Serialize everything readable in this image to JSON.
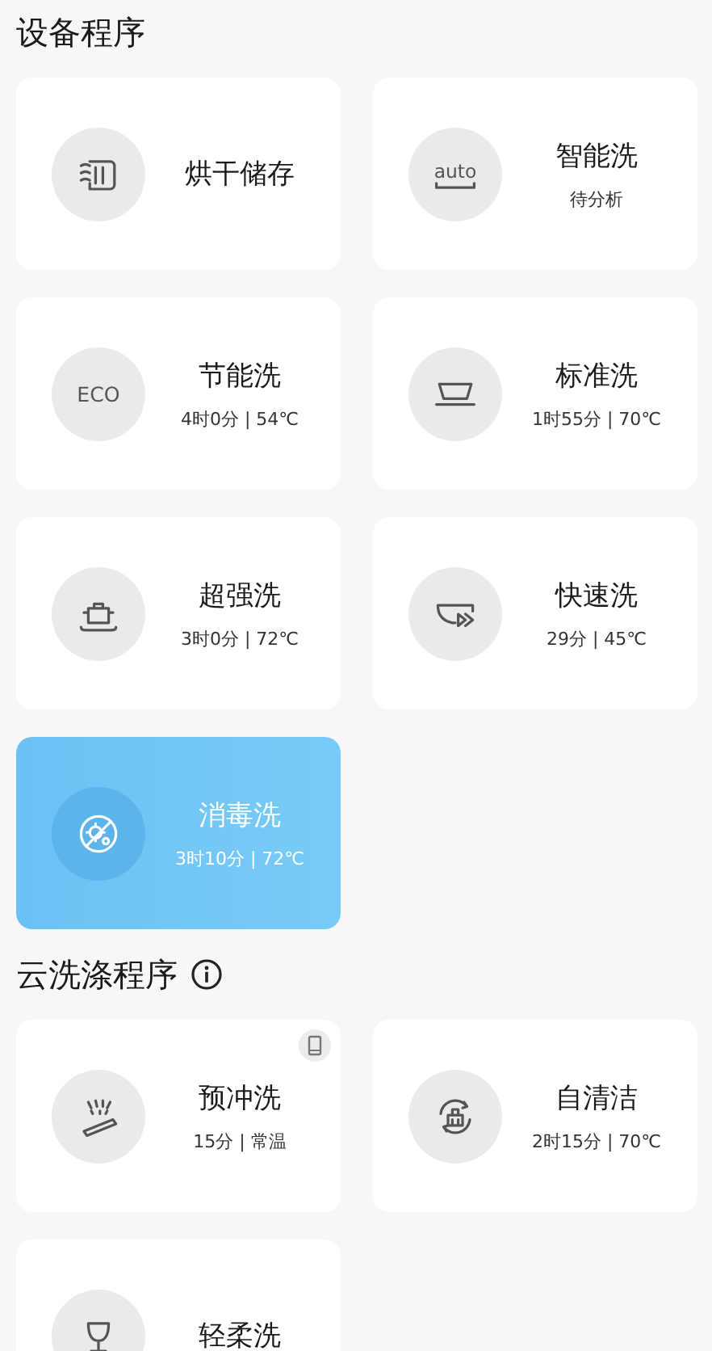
{
  "sections": [
    {
      "title": "设备程序",
      "info": false,
      "programs": [
        {
          "kind": "drawer",
          "name": "烘干储存",
          "selected": false
        },
        {
          "kind": "auto",
          "icon_label": "auto",
          "name": "智能洗",
          "detail": "待分析",
          "selected": false
        },
        {
          "kind": "eco",
          "icon_label": "ECO",
          "name": "节能洗",
          "detail": "4时0分 | 54℃",
          "selected": false
        },
        {
          "kind": "bowl",
          "name": "标准洗",
          "detail": "1时55分 | 70℃",
          "selected": false
        },
        {
          "kind": "pot",
          "name": "超强洗",
          "detail": "3时0分 | 72℃",
          "selected": false
        },
        {
          "kind": "fast",
          "name": "快速洗",
          "detail": "29分 | 45℃",
          "selected": false
        },
        {
          "kind": "germ",
          "name": "消毒洗",
          "detail": "3时10分 | 72℃",
          "selected": true
        }
      ]
    },
    {
      "title": "云洗涤程序",
      "info": true,
      "programs": [
        {
          "kind": "spray",
          "name": "预冲洗",
          "detail": "15分 | 常温",
          "selected": false,
          "phone_badge": true
        },
        {
          "kind": "selfclean",
          "name": "自清洁",
          "detail": "2时15分 | 70℃",
          "selected": false
        },
        {
          "kind": "glass",
          "name": "轻柔洗",
          "selected": false
        }
      ]
    }
  ]
}
